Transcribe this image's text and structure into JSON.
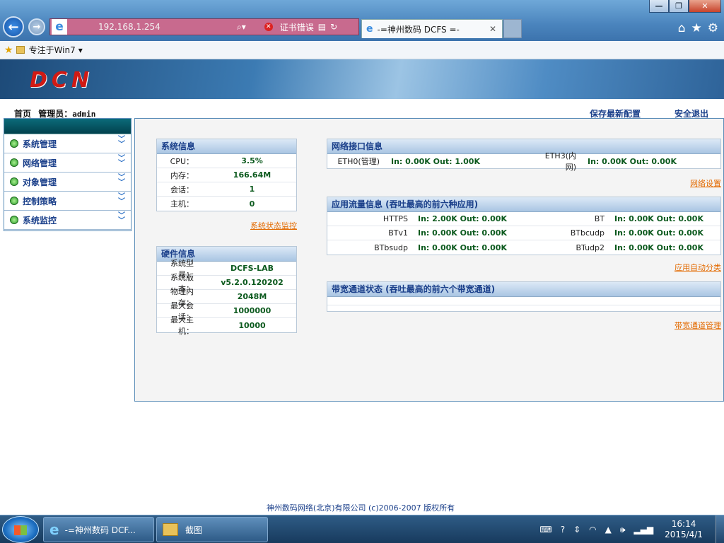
{
  "browser": {
    "address": "192.168.1.254",
    "cert_error": "证书错误",
    "tab_title": "-=神州数码 DCFS =-",
    "favorites_item": "专注于Win7"
  },
  "page": {
    "logo": "DCN",
    "home_label": "首页",
    "admin_label": "管理员：",
    "admin_user": "admin",
    "save_config": "保存最新配置",
    "logout": "安全退出"
  },
  "sidebar": {
    "items": [
      {
        "label": "系统管理"
      },
      {
        "label": "网络管理"
      },
      {
        "label": "对象管理"
      },
      {
        "label": "控制策略"
      },
      {
        "label": "系统监控"
      }
    ]
  },
  "system_info": {
    "title": "系统信息",
    "rows": [
      {
        "k": "CPU：",
        "v": "3.5%"
      },
      {
        "k": "内存：",
        "v": "166.64M"
      },
      {
        "k": "会话：",
        "v": "1"
      },
      {
        "k": "主机：",
        "v": "0"
      }
    ],
    "link": "系统状态监控"
  },
  "hardware_info": {
    "title": "硬件信息",
    "rows": [
      {
        "k": "系统型号：",
        "v": "DCFS-LAB"
      },
      {
        "k": "系统版本：",
        "v": "v5.2.0.120202"
      },
      {
        "k": "物理内存：",
        "v": "2048M"
      },
      {
        "k": "最大会话：",
        "v": "1000000"
      },
      {
        "k": "最大主机：",
        "v": "10000"
      }
    ]
  },
  "network_info": {
    "title": "网络接口信息",
    "eth0_name": "ETH0(管理)",
    "eth0_val": "In: 0.00K Out: 1.00K",
    "eth3_name": "ETH3(内网)",
    "eth3_val": "In: 0.00K Out: 0.00K",
    "link": "网络设置"
  },
  "app_traffic": {
    "title": "应用流量信息 (吞吐最高的前六种应用)",
    "rows": [
      {
        "n1": "HTTPS",
        "v1": "In: 2.00K Out: 0.00K",
        "n2": "BT",
        "v2": "In: 0.00K Out: 0.00K"
      },
      {
        "n1": "BTv1",
        "v1": "In: 0.00K Out: 0.00K",
        "n2": "BTbcudp",
        "v2": "In: 0.00K Out: 0.00K"
      },
      {
        "n1": "BTbsudp",
        "v1": "In: 0.00K Out: 0.00K",
        "n2": "BTudp2",
        "v2": "In: 0.00K Out: 0.00K"
      }
    ],
    "link": "应用自动分类"
  },
  "bandwidth": {
    "title": "带宽通道状态 (吞吐最高的前六个带宽通道)",
    "link": "带宽通道管理"
  },
  "footer": "神州数码网络(北京)有限公司 (c)2006-2007 版权所有",
  "taskbar": {
    "task_ie": "-=神州数码 DCF...",
    "task_folder": "截图",
    "time": "16:14",
    "date": "2015/4/1"
  }
}
